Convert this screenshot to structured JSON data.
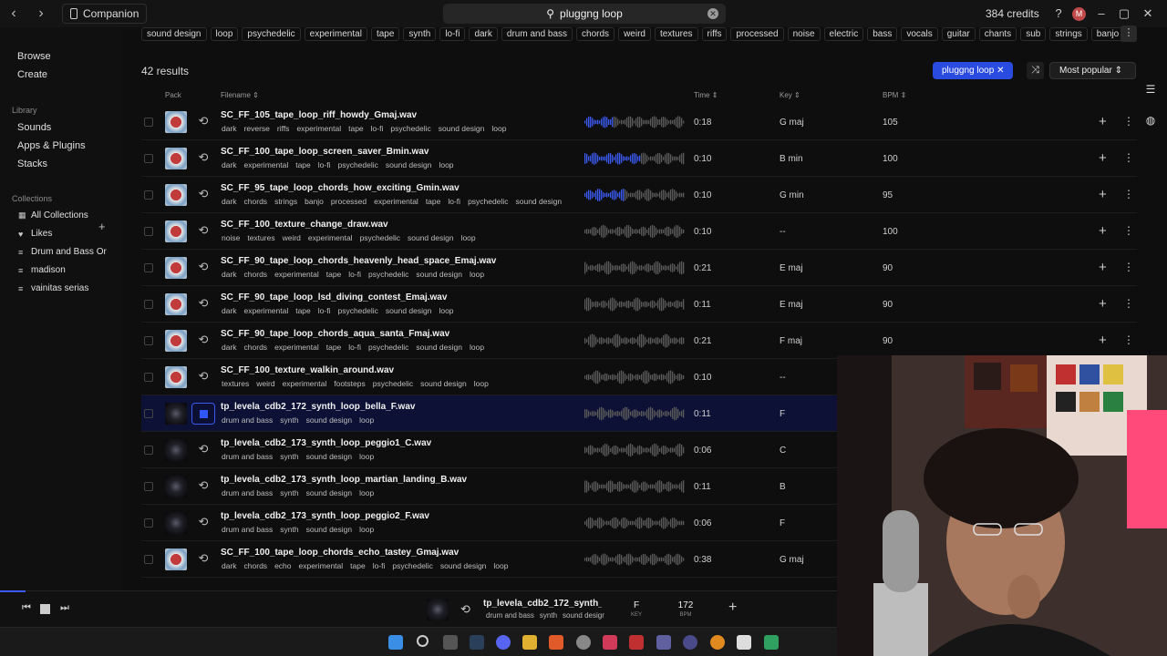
{
  "titlebar": {
    "companion_label": "Companion",
    "search_value": "pluggng loop",
    "credits": "384 credits",
    "avatar_initial": "M"
  },
  "sidebar": {
    "browse": "Browse",
    "create": "Create",
    "library_heading": "Library",
    "sounds": "Sounds",
    "apps_plugins": "Apps & Plugins",
    "stacks": "Stacks",
    "collections_heading": "Collections",
    "collections": [
      {
        "label": "All Collections",
        "icon": "grid-icon"
      },
      {
        "label": "Likes",
        "icon": "heart-icon"
      },
      {
        "label": "Drum and Bass Or",
        "icon": "collection-icon"
      },
      {
        "label": "madison",
        "icon": "collection-icon"
      },
      {
        "label": "vainitas serias",
        "icon": "collection-icon"
      }
    ]
  },
  "tag_filters": [
    "sound design",
    "loop",
    "psychedelic",
    "experimental",
    "tape",
    "synth",
    "lo-fi",
    "dark",
    "drum and bass",
    "chords",
    "weird",
    "textures",
    "riffs",
    "processed",
    "noise",
    "electric",
    "bass",
    "vocals",
    "guitar",
    "chants",
    "sub",
    "strings",
    "banjo"
  ],
  "results_count": "42 results",
  "active_filter": "pluggng loop",
  "sort_label": "Most popular",
  "columns": {
    "pack": "Pack",
    "filename": "Filename",
    "time": "Time",
    "key": "Key",
    "bpm": "BPM"
  },
  "rows": [
    {
      "file": "SC_FF_105_tape_loop_riff_howdy_Gmaj.wav",
      "tags": [
        "dark",
        "reverse",
        "riffs",
        "experimental",
        "tape",
        "lo-fi",
        "psychedelic",
        "sound design",
        "loop"
      ],
      "time": "0:18",
      "key": "G maj",
      "bpm": "105",
      "thumb": "a",
      "wave_color": "#3a5af0",
      "played": 0.28
    },
    {
      "file": "SC_FF_100_tape_loop_screen_saver_Bmin.wav",
      "tags": [
        "dark",
        "experimental",
        "tape",
        "lo-fi",
        "psychedelic",
        "sound design",
        "loop"
      ],
      "time": "0:10",
      "key": "B min",
      "bpm": "100",
      "thumb": "a",
      "wave_color": "#3a5af0",
      "played": 0.55
    },
    {
      "file": "SC_FF_95_tape_loop_chords_how_exciting_Gmin.wav",
      "tags": [
        "dark",
        "chords",
        "strings",
        "banjo",
        "processed",
        "experimental",
        "tape",
        "lo-fi",
        "psychedelic",
        "sound design"
      ],
      "time": "0:10",
      "key": "G min",
      "bpm": "95",
      "thumb": "a",
      "wave_color": "#3a5af0",
      "played": 0.4
    },
    {
      "file": "SC_FF_100_texture_change_draw.wav",
      "tags": [
        "noise",
        "textures",
        "weird",
        "experimental",
        "psychedelic",
        "sound design",
        "loop"
      ],
      "time": "0:10",
      "key": "--",
      "bpm": "100",
      "thumb": "a",
      "wave_color": "#6a6a6a",
      "played": 0
    },
    {
      "file": "SC_FF_90_tape_loop_chords_heavenly_head_space_Emaj.wav",
      "tags": [
        "dark",
        "chords",
        "experimental",
        "tape",
        "lo-fi",
        "psychedelic",
        "sound design",
        "loop"
      ],
      "time": "0:21",
      "key": "E maj",
      "bpm": "90",
      "thumb": "a",
      "wave_color": "#6a6a6a",
      "played": 0
    },
    {
      "file": "SC_FF_90_tape_loop_lsd_diving_contest_Emaj.wav",
      "tags": [
        "dark",
        "experimental",
        "tape",
        "lo-fi",
        "psychedelic",
        "sound design",
        "loop"
      ],
      "time": "0:11",
      "key": "E maj",
      "bpm": "90",
      "thumb": "a",
      "wave_color": "#6a6a6a",
      "played": 0
    },
    {
      "file": "SC_FF_90_tape_loop_chords_aqua_santa_Fmaj.wav",
      "tags": [
        "dark",
        "chords",
        "experimental",
        "tape",
        "lo-fi",
        "psychedelic",
        "sound design",
        "loop"
      ],
      "time": "0:21",
      "key": "F maj",
      "bpm": "90",
      "thumb": "a",
      "wave_color": "#6a6a6a",
      "played": 0
    },
    {
      "file": "SC_FF_100_texture_walkin_around.wav",
      "tags": [
        "textures",
        "weird",
        "experimental",
        "footsteps",
        "psychedelic",
        "sound design",
        "loop"
      ],
      "time": "0:10",
      "key": "--",
      "bpm": "",
      "thumb": "a",
      "wave_color": "#6a6a6a",
      "played": 0
    },
    {
      "file": "tp_levela_cdb2_172_synth_loop_bella_F.wav",
      "tags": [
        "drum and bass",
        "synth",
        "sound design",
        "loop"
      ],
      "time": "0:11",
      "key": "F",
      "bpm": "",
      "thumb": "b",
      "wave_color": "#6a6a6a",
      "played": 0,
      "active": true
    },
    {
      "file": "tp_levela_cdb2_173_synth_loop_peggio1_C.wav",
      "tags": [
        "drum and bass",
        "synth",
        "sound design",
        "loop"
      ],
      "time": "0:06",
      "key": "C",
      "bpm": "",
      "thumb": "b",
      "wave_color": "#6a6a6a",
      "played": 0
    },
    {
      "file": "tp_levela_cdb2_173_synth_loop_martian_landing_B.wav",
      "tags": [
        "drum and bass",
        "synth",
        "sound design",
        "loop"
      ],
      "time": "0:11",
      "key": "B",
      "bpm": "",
      "thumb": "b",
      "wave_color": "#6a6a6a",
      "played": 0
    },
    {
      "file": "tp_levela_cdb2_173_synth_loop_peggio2_F.wav",
      "tags": [
        "drum and bass",
        "synth",
        "sound design",
        "loop"
      ],
      "time": "0:06",
      "key": "F",
      "bpm": "",
      "thumb": "b",
      "wave_color": "#6a6a6a",
      "played": 0
    },
    {
      "file": "SC_FF_100_tape_loop_chords_echo_tastey_Gmaj.wav",
      "tags": [
        "dark",
        "chords",
        "echo",
        "experimental",
        "tape",
        "lo-fi",
        "psychedelic",
        "sound design",
        "loop"
      ],
      "time": "0:38",
      "key": "G maj",
      "bpm": "",
      "thumb": "a",
      "wave_color": "#6a6a6a",
      "played": 0
    }
  ],
  "player": {
    "title": "tp_levela_cdb2_172_synth_loop_bella_F.wav",
    "tags": [
      "drum and bass",
      "synth",
      "sound design",
      "loop"
    ],
    "key": "F",
    "key_label": "KEY",
    "bpm": "172",
    "bpm_label": "BPM",
    "progress": 0.03
  },
  "colors": {
    "accent": "#2a4be0",
    "background": "#0e0e0e",
    "active_row": "#0d1136"
  }
}
